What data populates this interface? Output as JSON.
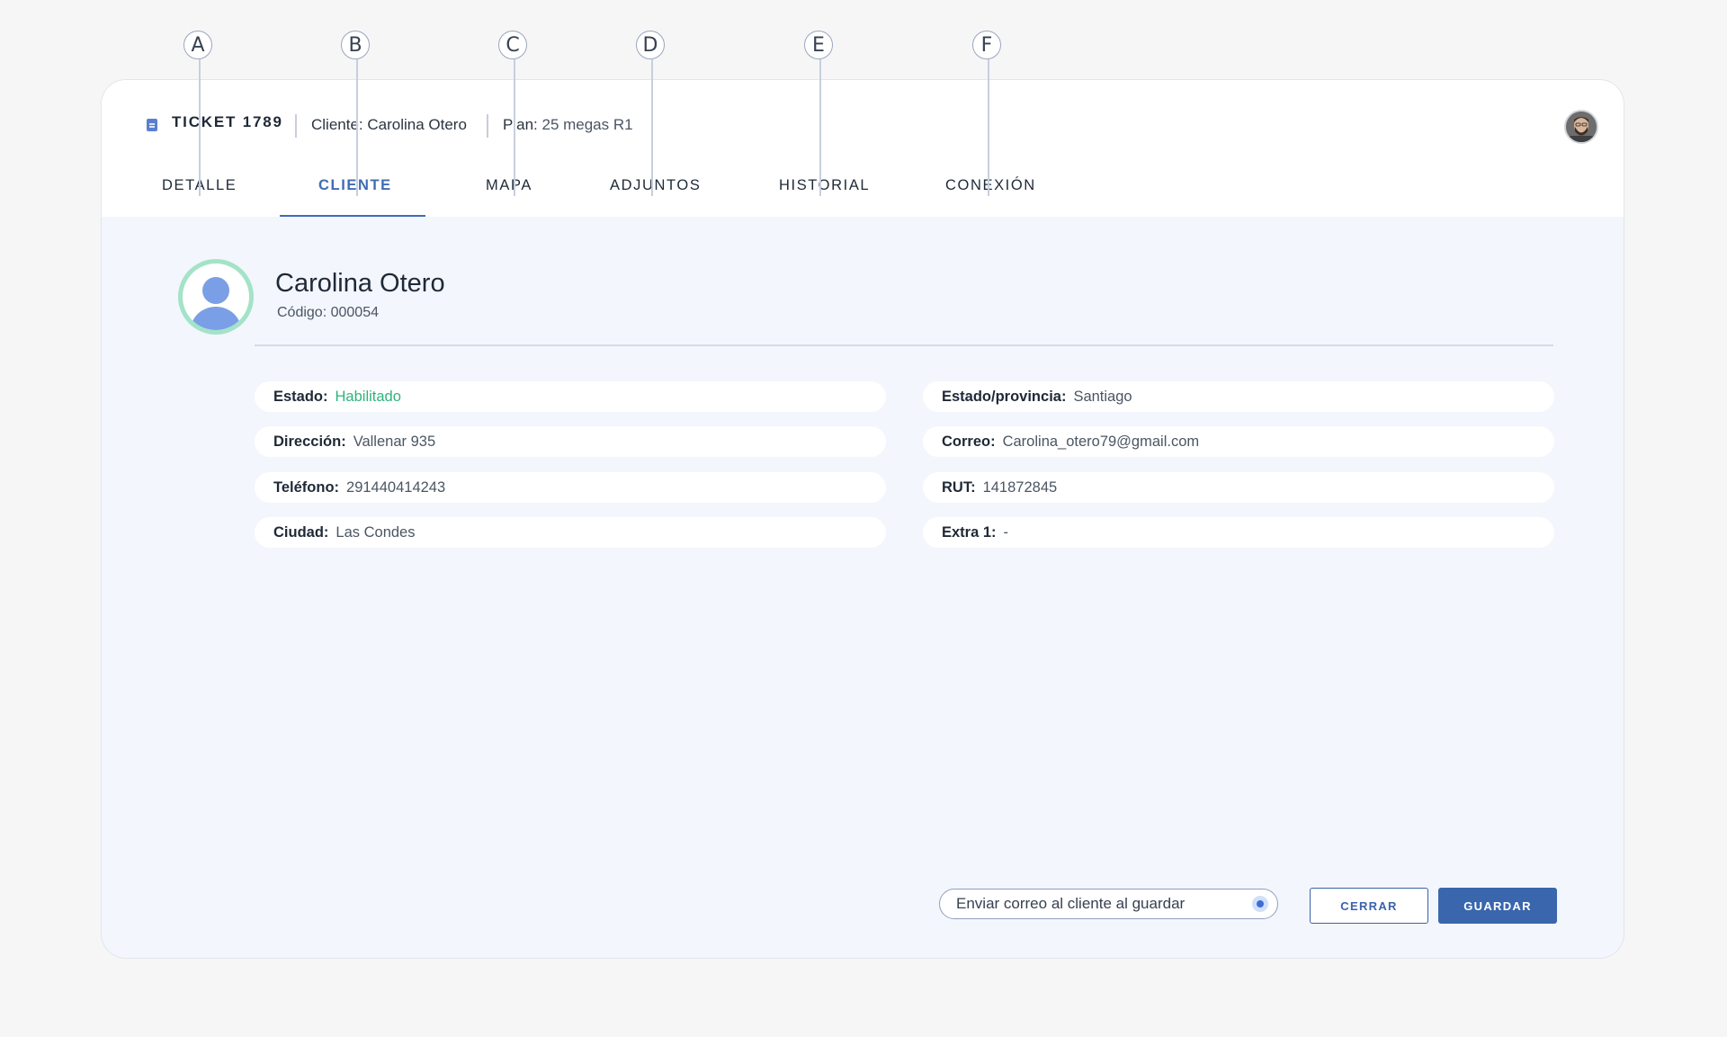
{
  "callouts": [
    "A",
    "B",
    "C",
    "D",
    "E",
    "F"
  ],
  "header": {
    "ticket": "TICKET 1789",
    "client_text": "Cliente: Carolina Otero",
    "plan_label": "Plan:",
    "plan_value": "25 megas R1"
  },
  "tabs": [
    {
      "label": "DETALLE"
    },
    {
      "label": "CLIENTE"
    },
    {
      "label": "MAPA"
    },
    {
      "label": "ADJUNTOS"
    },
    {
      "label": "HISTORIAL"
    },
    {
      "label": "CONEXIÓN"
    }
  ],
  "active_tab": "CLIENTE",
  "profile": {
    "name": "Carolina Otero",
    "code": "Código: 000054"
  },
  "fields_left": [
    {
      "label": "Estado:",
      "value": "Habilitado"
    },
    {
      "label": "Dirección:",
      "value": "Vallenar 935"
    },
    {
      "label": "Teléfono:",
      "value": "291440414243"
    },
    {
      "label": "Ciudad:",
      "value": "Las Condes"
    }
  ],
  "fields_right": [
    {
      "label": "Estado/provincia:",
      "value": "Santiago"
    },
    {
      "label": "Correo:",
      "value": "Carolina_otero79@gmail.com"
    },
    {
      "label": "RUT:",
      "value": "141872845"
    },
    {
      "label": "Extra 1:",
      "value": "-"
    }
  ],
  "footer": {
    "notify_label": "Enviar correo al cliente al guardar",
    "notify_checked": true,
    "close_label": "CERRAR",
    "save_label": "GUARDAR"
  },
  "colors": {
    "accent": "#3f6cb6",
    "status_green": "#2fb37a",
    "primary_button": "#3a66ad",
    "profile_ring": "#a3e3c8",
    "background": "#f3f6fc"
  }
}
